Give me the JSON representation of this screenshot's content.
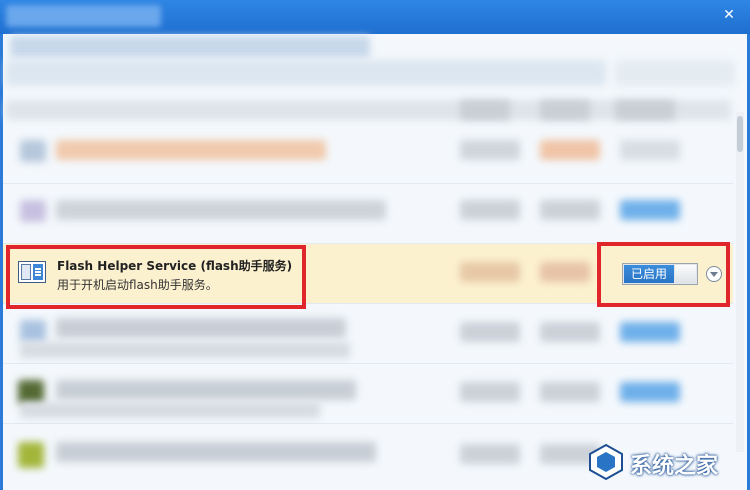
{
  "window": {
    "close_glyph": "✕"
  },
  "service": {
    "name": "Flash Helper Service (flash助手服务)",
    "description": "用于开机启动flash助手服务。",
    "icon": "service-window-icon"
  },
  "toggle": {
    "label": "已启用",
    "state": "enabled"
  },
  "dropdown": {
    "icon": "chevron-down-icon"
  },
  "watermark": {
    "text": "系统之家"
  },
  "colors": {
    "titlebar": "#1f6fd0",
    "highlight_row": "#fcf1cf",
    "annotation_red": "#e0262a",
    "toggle_blue": "#2a74c5"
  }
}
